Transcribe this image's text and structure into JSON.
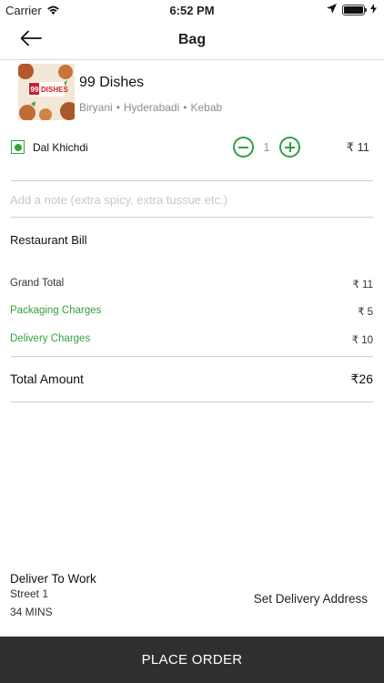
{
  "status_bar": {
    "carrier": "Carrier",
    "time": "6:52 PM",
    "battery_level": 1.0
  },
  "nav": {
    "title": "Bag",
    "back_icon": "arrow-left-icon"
  },
  "restaurant": {
    "name": "99 Dishes",
    "logo_text": "DISHES",
    "logo_number": "99",
    "cuisines": [
      "Biryani",
      "Hyderabadi",
      "Kebab"
    ],
    "separator": "•"
  },
  "item": {
    "name": "Dal Khichdi",
    "quantity": "1",
    "price": "₹ 11",
    "veg": true
  },
  "note": {
    "placeholder": "Add a note (extra spicy, extra tussue etc.)",
    "value": ""
  },
  "bill": {
    "heading": "Restaurant Bill",
    "rows": [
      {
        "label": "Grand Total",
        "value": "₹ 11"
      },
      {
        "label": "Packaging Charges",
        "value": "₹ 5"
      },
      {
        "label": "Delivery Charges",
        "value": "₹ 10"
      }
    ],
    "total_label": "Total Amount",
    "total_value": "₹26"
  },
  "delivery": {
    "title": "Deliver To Work",
    "street": "Street 1",
    "eta": "34 MINS",
    "set_address_label": "Set Delivery Address"
  },
  "place_order_label": "PLACE ORDER",
  "colors": {
    "accent_green": "#35a13a",
    "button_dark": "#2f2f2f",
    "logo_red": "#c8202c"
  }
}
